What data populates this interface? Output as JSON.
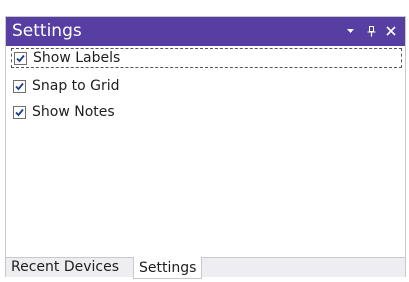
{
  "panel": {
    "title": "Settings",
    "buttons": {
      "dropdown_icon": "chevron-down-icon",
      "pin_icon": "pin-icon",
      "close_icon": "close-icon"
    },
    "colors": {
      "titlebar": "#563ea3",
      "title_text": "#ffffff"
    }
  },
  "options": [
    {
      "label": "Show Labels",
      "checked": true
    },
    {
      "label": "Snap to Grid",
      "checked": true
    },
    {
      "label": "Show Notes",
      "checked": true
    }
  ],
  "tabs": [
    {
      "label": "Recent Devices",
      "active": false
    },
    {
      "label": "Settings",
      "active": true
    }
  ]
}
